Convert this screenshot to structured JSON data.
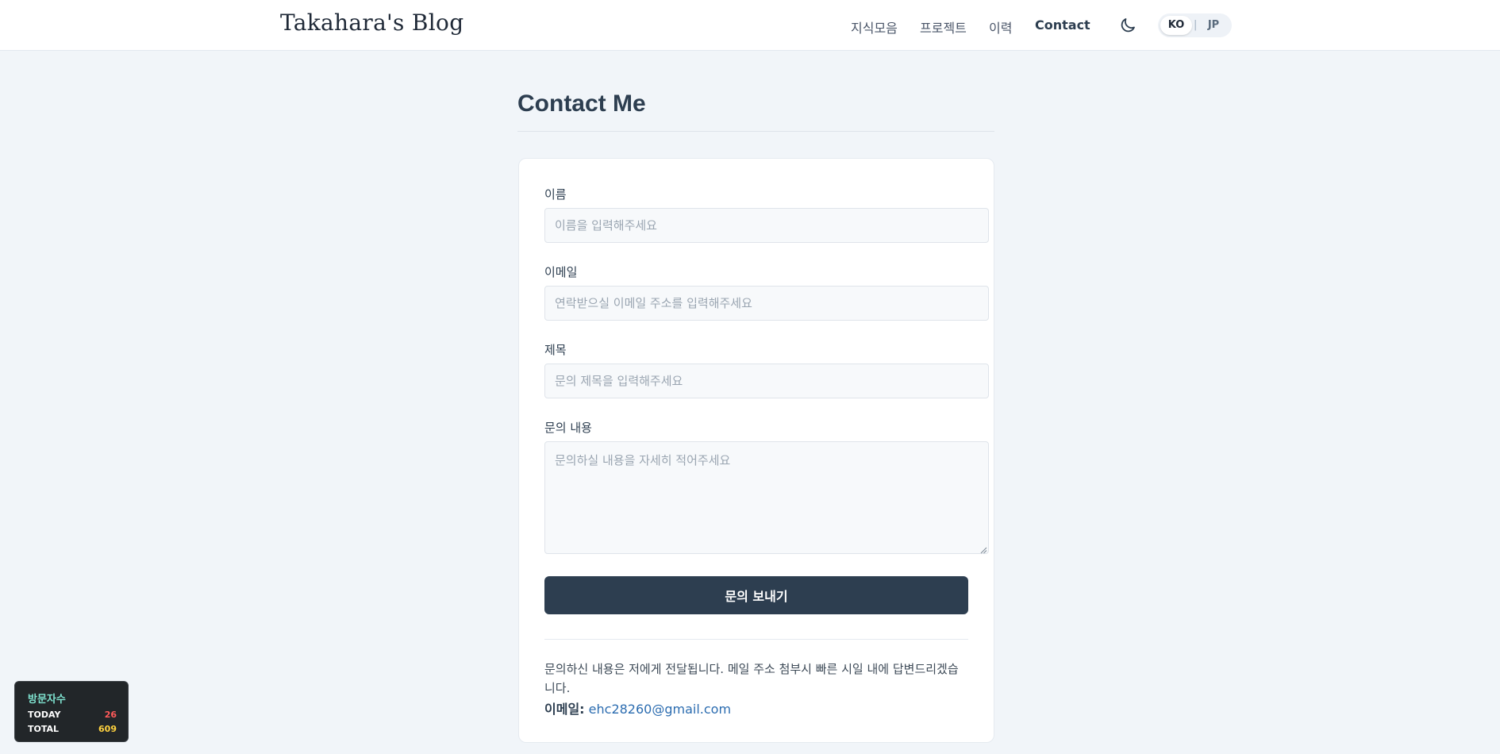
{
  "header": {
    "brand": "Takahara's Blog",
    "nav": [
      {
        "label": "지식모음",
        "active": false
      },
      {
        "label": "프로젝트",
        "active": false
      },
      {
        "label": "이력",
        "active": false
      },
      {
        "label": "Contact",
        "active": true
      }
    ],
    "theme_icon": "moon-icon",
    "lang": {
      "ko": "KO",
      "separator": "|",
      "jp": "JP",
      "selected": "KO"
    }
  },
  "page": {
    "title": "Contact Me"
  },
  "form": {
    "name": {
      "label": "이름",
      "placeholder": "이름을 입력해주세요",
      "value": ""
    },
    "email": {
      "label": "이메일",
      "placeholder": "연락받으실 이메일 주소를 입력해주세요",
      "value": ""
    },
    "subject": {
      "label": "제목",
      "placeholder": "문의 제목을 입력해주세요",
      "value": ""
    },
    "message": {
      "label": "문의 내용",
      "placeholder": "문의하실 내용을 자세히 적어주세요",
      "value": ""
    },
    "submit_label": "문의 보내기"
  },
  "info": {
    "note": "문의하신 내용은 저에게 전달됩니다. 메일 주소 첨부시 빠른 시일 내에 답변드리겠습니다.",
    "email_label": "이메일:",
    "email": "ehc28260@gmail.com"
  },
  "visitors": {
    "title": "방문자수",
    "today_label": "TODAY",
    "today": "26",
    "total_label": "TOTAL",
    "total": "609"
  },
  "colors": {
    "background": "#f1f5f9",
    "primary": "#2d3e50",
    "link": "#2b6cb0",
    "visitor_today": "#ff5a5a",
    "visitor_total": "#ffd23f"
  }
}
